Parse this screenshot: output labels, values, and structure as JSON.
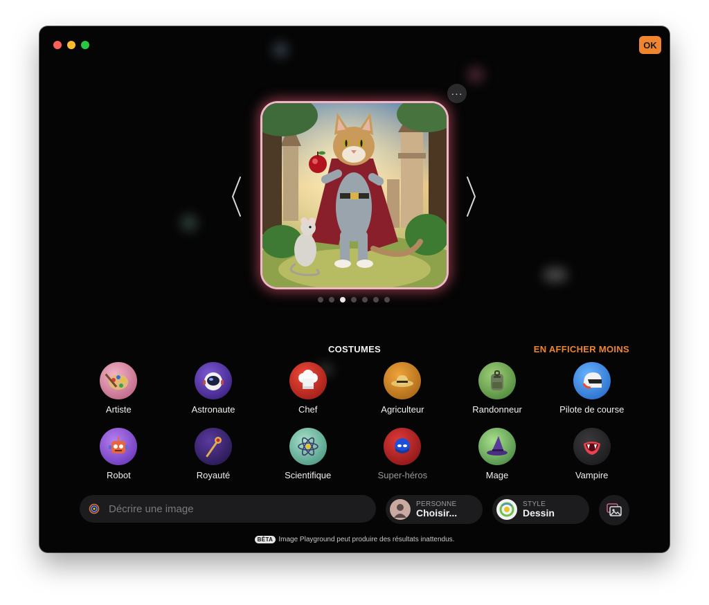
{
  "window": {
    "ok_label": "OK"
  },
  "preview": {
    "more_label": "···",
    "page_count": 7,
    "active_index": 2
  },
  "costumes": {
    "title": "COSTUMES",
    "toggle_label": "EN AFFICHER MOINS",
    "items": [
      {
        "label": "Artiste",
        "icon": "palette-icon"
      },
      {
        "label": "Astronaute",
        "icon": "astronaut-icon"
      },
      {
        "label": "Chef",
        "icon": "chef-hat-icon"
      },
      {
        "label": "Agriculteur",
        "icon": "straw-hat-icon"
      },
      {
        "label": "Randonneur",
        "icon": "backpack-icon"
      },
      {
        "label": "Pilote de course",
        "icon": "racing-helmet-icon"
      },
      {
        "label": "Robot",
        "icon": "robot-icon"
      },
      {
        "label": "Royauté",
        "icon": "scepter-icon"
      },
      {
        "label": "Scientifique",
        "icon": "atom-icon"
      },
      {
        "label": "Super-héros",
        "icon": "superhero-mask-icon"
      },
      {
        "label": "Mage",
        "icon": "wizard-hat-icon"
      },
      {
        "label": "Vampire",
        "icon": "vampire-fangs-icon"
      }
    ]
  },
  "prompt": {
    "placeholder": "Décrire une image"
  },
  "person": {
    "caption": "PERSONNE",
    "value": "Choisir..."
  },
  "style": {
    "caption": "STYLE",
    "value": "Dessin"
  },
  "footer": {
    "badge": "BÊTA",
    "text": "Image Playground peut produire des résultats inattendus."
  },
  "colors": {
    "accent": "#f0852f",
    "window_bg": "#050505",
    "pill_bg": "#1c1c1e"
  }
}
